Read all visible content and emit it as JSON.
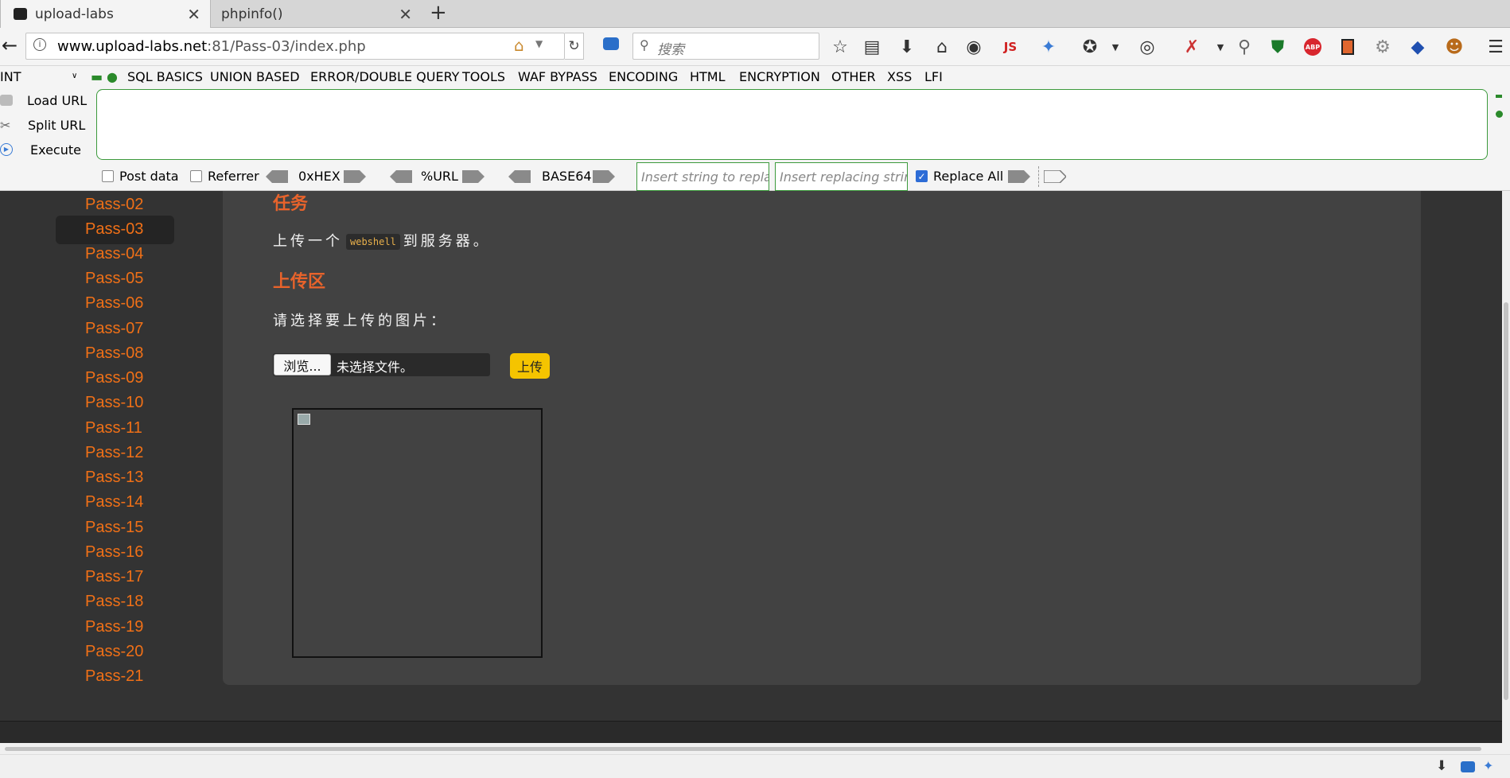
{
  "tabs": [
    {
      "title": "upload-labs"
    },
    {
      "title": "phpinfo()"
    }
  ],
  "navbar": {
    "url_domain": "www.upload-labs.net",
    "url_rest": ":81/Pass-03/index.php",
    "search_placeholder": "搜索"
  },
  "hackbar": {
    "dropdown_value": "INT",
    "menu": [
      "SQL BASICS",
      "UNION BASED",
      "ERROR/DOUBLE QUERY",
      "TOOLS",
      "WAF BYPASS",
      "ENCODING",
      "HTML",
      "ENCRYPTION",
      "OTHER",
      "XSS",
      "LFI"
    ],
    "load_url": "Load URL",
    "split_url": "Split URL",
    "execute": "Execute",
    "post_data": "Post data",
    "referrer": "Referrer",
    "hex": "0xHEX",
    "url": "%URL",
    "base64": "BASE64",
    "insert_string_placeholder": "Insert string to replace",
    "insert_replacing_placeholder": "Insert replacing string",
    "replace_all": "Replace All",
    "replace_all_checked": true
  },
  "sidebar": {
    "items": [
      "Pass-02",
      "Pass-03",
      "Pass-04",
      "Pass-05",
      "Pass-06",
      "Pass-07",
      "Pass-08",
      "Pass-09",
      "Pass-10",
      "Pass-11",
      "Pass-12",
      "Pass-13",
      "Pass-14",
      "Pass-15",
      "Pass-16",
      "Pass-17",
      "Pass-18",
      "Pass-19",
      "Pass-20",
      "Pass-21"
    ],
    "selected": "Pass-03"
  },
  "main": {
    "task_heading": "任务",
    "task_text_before": "上传一个",
    "task_code": "webshell",
    "task_text_after": "到服务器。",
    "upload_heading": "上传区",
    "select_prompt": "请选择要上传的图片：",
    "browse_label": "浏览...",
    "no_file_label": "未选择文件。",
    "upload_button": "上传"
  },
  "colors": {
    "accent_orange": "#e8632b",
    "sidebar_link": "#f07017",
    "upload_button": "#f5c400",
    "hackbar_green": "#3c9a3c"
  }
}
